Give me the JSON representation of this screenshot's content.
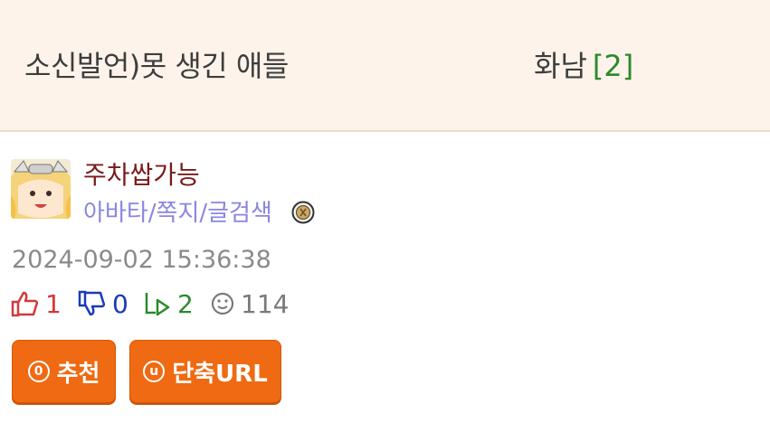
{
  "header": {
    "title": "소신발언)못 생긴 애들",
    "author": "화남",
    "comment_count": "[2]"
  },
  "user": {
    "nickname": "주차쌉가능",
    "links": "아바타/쪽지/글검색",
    "avatar_icon": "avatar-anime-girl",
    "level_icon": "level-badge-icon"
  },
  "post_meta": {
    "datetime": "2024-09-02 15:36:38"
  },
  "stats": {
    "up": "1",
    "down": "0",
    "replies": "2",
    "views": "114",
    "up_color": "#d23a3a",
    "down_color": "#1a3ab8",
    "reply_color": "#2a8a2a",
    "views_color": "#7a7a7a"
  },
  "buttons": {
    "recommend_label": "추천",
    "recommend_icon_glyph": "0",
    "shorturl_label": "단축URL",
    "shorturl_icon_glyph": "u",
    "color": "#ef6a12"
  }
}
